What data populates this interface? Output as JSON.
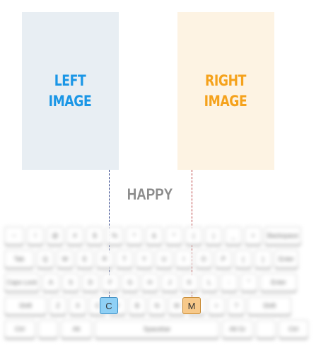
{
  "left_panel": {
    "label": "LEFT\nIMAGE",
    "color": "#1a96e6"
  },
  "right_panel": {
    "label": "RIGHT\nIMAGE",
    "color": "#f5a21c"
  },
  "emotion_label": "HAPPY",
  "keyboard": {
    "rows": [
      [
        {
          "t": "~",
          "w": 28
        },
        {
          "t": "!",
          "w": 24
        },
        {
          "t": "@",
          "w": 24
        },
        {
          "t": "#",
          "w": 24
        },
        {
          "t": "$",
          "w": 24
        },
        {
          "t": "%",
          "w": 24
        },
        {
          "t": "^",
          "w": 24
        },
        {
          "t": "&",
          "w": 24
        },
        {
          "t": "*",
          "w": 24
        },
        {
          "t": "(",
          "w": 24
        },
        {
          "t": ")",
          "w": 24
        },
        {
          "t": "_",
          "w": 24
        },
        {
          "t": "+",
          "w": 24
        },
        {
          "t": "Backspace",
          "w": 52
        }
      ],
      [
        {
          "t": "Tab",
          "w": 42
        },
        {
          "t": "Q",
          "w": 24
        },
        {
          "t": "W",
          "w": 24
        },
        {
          "t": "E",
          "w": 24
        },
        {
          "t": "R",
          "w": 24
        },
        {
          "t": "T",
          "w": 24
        },
        {
          "t": "Y",
          "w": 24
        },
        {
          "t": "U",
          "w": 24
        },
        {
          "t": "I",
          "w": 24
        },
        {
          "t": "O",
          "w": 24
        },
        {
          "t": "P",
          "w": 24
        },
        {
          "t": "{",
          "w": 24
        },
        {
          "t": "}",
          "w": 24
        },
        {
          "t": "Enter",
          "w": 34
        }
      ],
      [
        {
          "t": "Caps Lock",
          "w": 50
        },
        {
          "t": "A",
          "w": 24
        },
        {
          "t": "S",
          "w": 24
        },
        {
          "t": "D",
          "w": 24
        },
        {
          "t": "F",
          "w": 24
        },
        {
          "t": "G",
          "w": 24
        },
        {
          "t": "H",
          "w": 24
        },
        {
          "t": "J",
          "w": 24
        },
        {
          "t": "K",
          "w": 24
        },
        {
          "t": "L",
          "w": 24
        },
        {
          "t": ":",
          "w": 24
        },
        {
          "t": "\"",
          "w": 24
        },
        {
          "t": "Enter",
          "w": 52
        }
      ],
      [
        {
          "t": "Shift",
          "w": 60
        },
        {
          "t": "Z",
          "w": 24
        },
        {
          "t": "X",
          "w": 24
        },
        {
          "t": "C",
          "w": 24
        },
        {
          "t": "V",
          "w": 24
        },
        {
          "t": "B",
          "w": 24
        },
        {
          "t": "N",
          "w": 24
        },
        {
          "t": "M",
          "w": 24
        },
        {
          "t": "<",
          "w": 24
        },
        {
          "t": ">",
          "w": 24
        },
        {
          "t": "?",
          "w": 24
        },
        {
          "t": "Shift",
          "w": 62
        }
      ],
      [
        {
          "t": "Ctrl",
          "w": 44
        },
        {
          "t": "",
          "w": 28
        },
        {
          "t": "Alt",
          "w": 44
        },
        {
          "t": "Spacebar",
          "w": 176
        },
        {
          "t": "Alt Gr",
          "w": 44
        },
        {
          "t": "",
          "w": 28
        },
        {
          "t": "Ctrl",
          "w": 42
        }
      ]
    ],
    "highlighted_left_key": "C",
    "highlighted_right_key": "M",
    "left_key_color": "#8fd0f5",
    "right_key_color": "#f7c98a"
  }
}
